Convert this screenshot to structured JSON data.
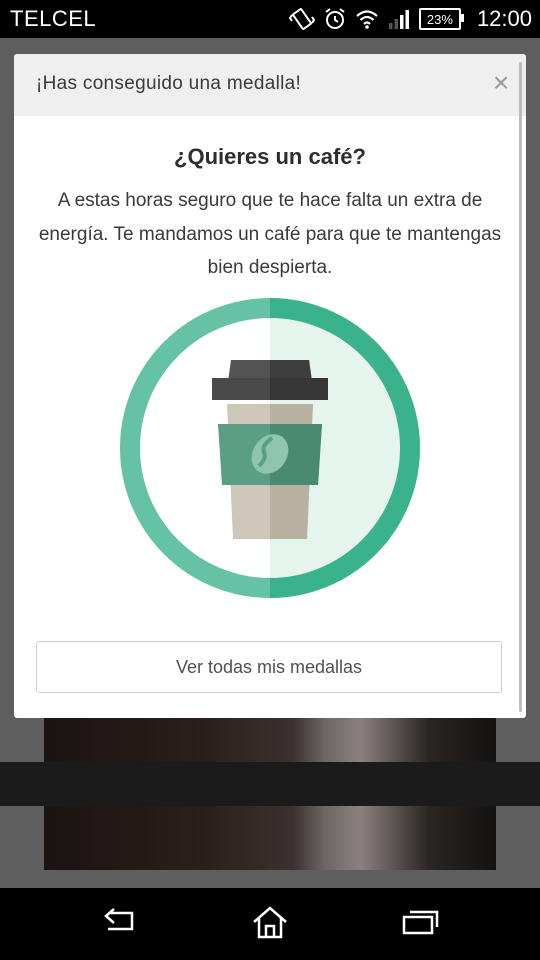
{
  "status_bar": {
    "carrier": "TELCEL",
    "battery": "23%",
    "time": "12:00",
    "icons": [
      "vibrate-icon",
      "alarm-icon",
      "wifi-icon",
      "signal-icon",
      "battery-icon"
    ]
  },
  "modal": {
    "header_title": "¡Has conseguido una medalla!",
    "close_label": "×",
    "badge_title": "¿Quieres un café?",
    "badge_description": "A estas horas seguro que te hace falta un extra de energía. Te mandamos un café para que te mantengas bien despierta.",
    "badge_icon": "coffee-cup-icon",
    "view_all_label": "Ver todas mis medallas"
  },
  "colors": {
    "ring_left": "#66c2a5",
    "ring_right": "#3ab38c",
    "cup_sleeve": "#4e9a80",
    "cup_lid": "#454545",
    "cup_body": "#c9c4b6"
  },
  "nav_bar": {
    "icons": [
      "back-icon",
      "home-icon",
      "recent-apps-icon"
    ]
  }
}
